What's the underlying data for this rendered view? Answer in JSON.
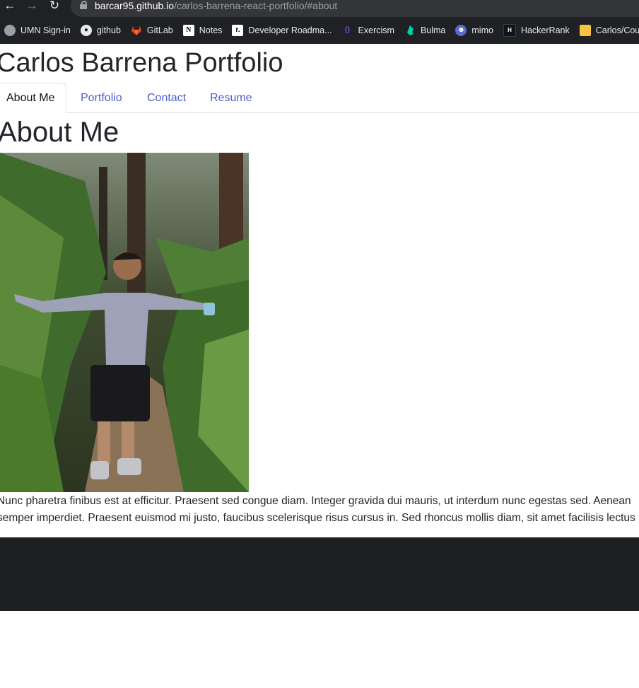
{
  "browser": {
    "url_host": "barcar95.github.io",
    "url_path": "/carlos-barrena-react-portfolio/#about",
    "bookmarks": [
      {
        "label": "UMN Sign-in",
        "icon": "globe-icon"
      },
      {
        "label": "github",
        "icon": "github-icon"
      },
      {
        "label": "GitLab",
        "icon": "gitlab-icon"
      },
      {
        "label": "Notes",
        "icon": "notion-icon"
      },
      {
        "label": "Developer Roadma...",
        "icon": "roadmap-icon"
      },
      {
        "label": "Exercism",
        "icon": "exercism-icon"
      },
      {
        "label": "Bulma",
        "icon": "bulma-icon"
      },
      {
        "label": "mimo",
        "icon": "mimo-icon"
      },
      {
        "label": "HackerRank",
        "icon": "hackerrank-icon"
      },
      {
        "label": "Carlos/Cou",
        "icon": "folder-icon"
      }
    ]
  },
  "site": {
    "title": "Carlos Barrena Portfolio",
    "tabs": [
      {
        "label": "About Me",
        "active": true
      },
      {
        "label": "Portfolio",
        "active": false
      },
      {
        "label": "Contact",
        "active": false
      },
      {
        "label": "Resume",
        "active": false
      }
    ]
  },
  "about": {
    "heading": "About Me",
    "bio_lines": [
      "Nunc pharetra finibus est at efficitur. Praesent sed congue diam. Integer gravida dui mauris, ut interdum nunc egestas sed. Aenean",
      "semper imperdiet. Praesent euismod mi justo, faucibus scelerisque risus cursus in. Sed rhoncus mollis diam, sit amet facilisis lectus"
    ]
  },
  "colors": {
    "chrome_bg": "#202124",
    "tab_link": "#4f5bd5",
    "footer_bg": "#1c1e22"
  }
}
